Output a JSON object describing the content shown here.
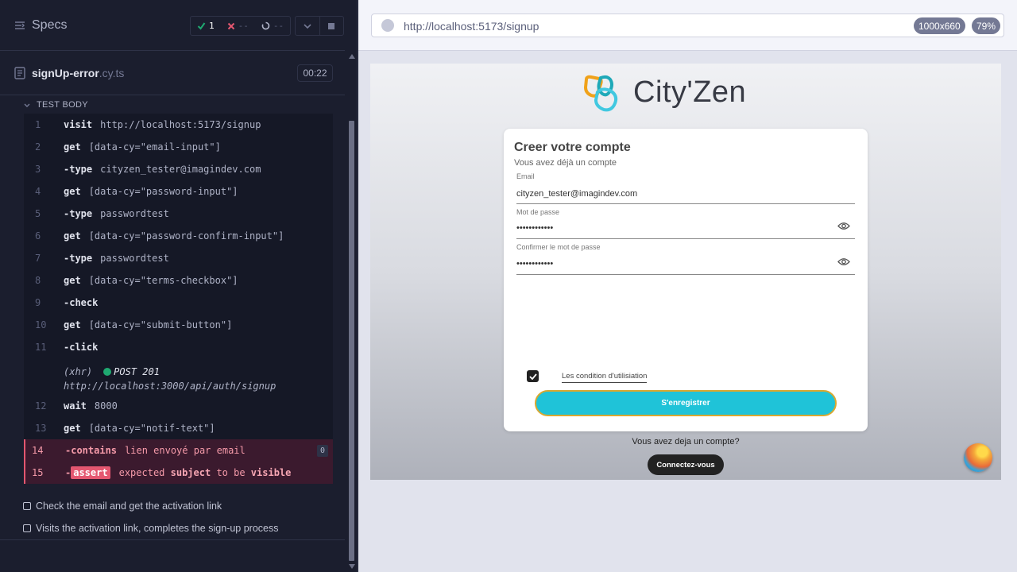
{
  "reporter": {
    "title": "Specs",
    "stats": {
      "passed": "1",
      "failed": "--",
      "pending": "--"
    },
    "spec": {
      "name": "signUp-error",
      "ext": ".cy.ts",
      "duration": "00:22"
    },
    "section_label": "TEST BODY",
    "commands": [
      {
        "num": "1",
        "name": "visit",
        "arg": "http://localhost:5173/signup"
      },
      {
        "num": "2",
        "name": "get",
        "arg": "[data-cy=\"email-input\"]"
      },
      {
        "num": "3",
        "name": "type",
        "arg": "cityzen_tester@imagindev.com"
      },
      {
        "num": "4",
        "name": "get",
        "arg": "[data-cy=\"password-input\"]"
      },
      {
        "num": "5",
        "name": "type",
        "arg": "passwordtest"
      },
      {
        "num": "6",
        "name": "get",
        "arg": "[data-cy=\"password-confirm-input\"]"
      },
      {
        "num": "7",
        "name": "type",
        "arg": "passwordtest"
      },
      {
        "num": "8",
        "name": "get",
        "arg": "[data-cy=\"terms-checkbox\"]"
      },
      {
        "num": "9",
        "name": "check",
        "arg": ""
      },
      {
        "num": "10",
        "name": "get",
        "arg": "[data-cy=\"submit-button\"]"
      },
      {
        "num": "11",
        "name": "click",
        "arg": ""
      },
      {
        "num": "12",
        "name": "wait",
        "arg": "8000"
      },
      {
        "num": "13",
        "name": "get",
        "arg": "[data-cy=\"notif-text\"]"
      },
      {
        "num": "14",
        "name": "contains",
        "arg": "lien envoyé par email",
        "count": "0"
      },
      {
        "num": "15",
        "name": "assert",
        "arg_parts": [
          "expected",
          "subject",
          "to be",
          "visible"
        ]
      }
    ],
    "xhr": {
      "label": "(xhr)",
      "method": "POST 201",
      "url": "http://localhost:3000/api/auth/signup"
    },
    "pending_tests": [
      "Check the email and get the activation link",
      "Visits the activation link, completes the sign-up process"
    ]
  },
  "aut": {
    "url": "http://localhost:5173/signup",
    "viewport": "1000x660",
    "zoom": "79%",
    "app": {
      "logo_text": "City'Zen",
      "card_title": "Creer votre compte",
      "card_subtitle": "Vous avez déjà un compte",
      "email_label": "Email",
      "email_value": "cityzen_tester@imagindev.com",
      "password_label": "Mot de passe",
      "password_value": "••••••••••••",
      "confirm_label": "Confirmer le mot de passe",
      "confirm_value": "••••••••••••",
      "terms_label": "Les condition d'utilisiation",
      "submit_label": "S'enregistrer",
      "already_text": "Vous avez deja un compte?",
      "login_label": "Connectez-vous"
    }
  },
  "colors": {
    "accent_cyan": "#1fc3d8",
    "error_red": "#e45770",
    "pass_green": "#1fa971"
  }
}
